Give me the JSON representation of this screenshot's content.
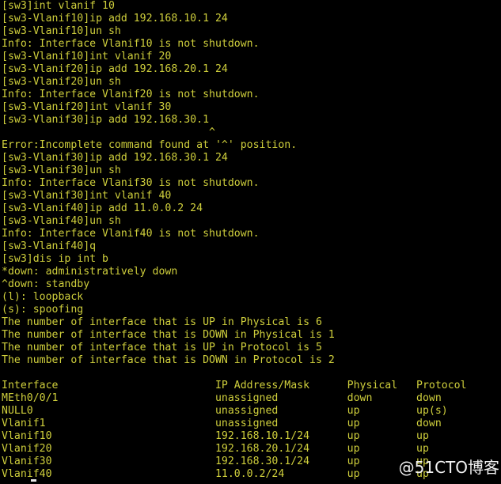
{
  "terminal": {
    "device_prompt": "[sw3]",
    "colors": {
      "background": "#000000",
      "foreground": "#cfcf3c",
      "watermark": "#f2f2f2",
      "cursor": "#e8e8e8"
    },
    "cursor": {
      "visible": true,
      "glyph": "_"
    },
    "watermark": {
      "text": "@51CTO博客"
    },
    "lines": [
      "[sw3]int vlanif 10",
      "[sw3-Vlanif10]ip add 192.168.10.1 24",
      "[sw3-Vlanif10]un sh",
      "Info: Interface Vlanif10 is not shutdown.",
      "[sw3-Vlanif10]int vlanif 20",
      "[sw3-Vlanif20]ip add 192.168.20.1 24",
      "[sw3-Vlanif20]un sh",
      "Info: Interface Vlanif20 is not shutdown.",
      "[sw3-Vlanif20]int vlanif 30",
      "[sw3-Vlanif30]ip add 192.168.30.1",
      "                                 ^",
      "Error:Incomplete command found at '^' position.",
      "[sw3-Vlanif30]ip add 192.168.30.1 24",
      "[sw3-Vlanif30]un sh",
      "Info: Interface Vlanif30 is not shutdown.",
      "[sw3-Vlanif30]int vlanif 40",
      "[sw3-Vlanif40]ip add 11.0.0.2 24",
      "[sw3-Vlanif40]un sh",
      "Info: Interface Vlanif40 is not shutdown.",
      "[sw3-Vlanif40]q",
      "[sw3]dis ip int b",
      "*down: administratively down",
      "^down: standby",
      "(l): loopback",
      "(s): spoofing",
      "The number of interface that is UP in Physical is 6",
      "The number of interface that is DOWN in Physical is 1",
      "The number of interface that is UP in Protocol is 5",
      "The number of interface that is DOWN in Protocol is 2",
      "",
      "Interface                         IP Address/Mask      Physical   Protocol",
      "MEth0/0/1                         unassigned           down       down",
      "NULL0                             unassigned           up         up(s)",
      "Vlanif1                           unassigned           up         down",
      "Vlanif10                          192.168.10.1/24      up         up",
      "Vlanif20                          192.168.20.1/24      up         up",
      "Vlanif30                          192.168.30.1/24      up         up",
      "Vlanif40                          11.0.0.2/24          up         up"
    ],
    "legend": {
      "administratively_down": "*down: administratively down",
      "standby": "^down: standby",
      "loopback": "(l): loopback",
      "spoofing": "(s): spoofing"
    },
    "counters": {
      "up_physical": 6,
      "down_physical": 1,
      "up_protocol": 5,
      "down_protocol": 2
    },
    "interface_table": {
      "headers": [
        "Interface",
        "IP Address/Mask",
        "Physical",
        "Protocol"
      ],
      "rows": [
        [
          "MEth0/0/1",
          "unassigned",
          "down",
          "down"
        ],
        [
          "NULL0",
          "unassigned",
          "up",
          "up(s)"
        ],
        [
          "Vlanif1",
          "unassigned",
          "up",
          "down"
        ],
        [
          "Vlanif10",
          "192.168.10.1/24",
          "up",
          "up"
        ],
        [
          "Vlanif20",
          "192.168.20.1/24",
          "up",
          "up"
        ],
        [
          "Vlanif30",
          "192.168.30.1/24",
          "up",
          "up"
        ],
        [
          "Vlanif40",
          "11.0.0.2/24",
          "up",
          "up"
        ]
      ]
    },
    "error_message": "Error:Incomplete command found at '^' position."
  }
}
